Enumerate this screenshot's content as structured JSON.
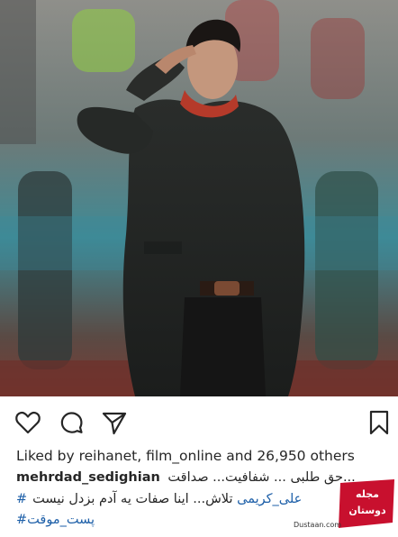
{
  "post": {
    "likes": {
      "prefix": "Liked by ",
      "names": "reihanet, film_online",
      "middle": " and ",
      "count": "26,950 others"
    },
    "caption": {
      "username": "mehrdad_sedighian",
      "line1_text": "حق طلبی ... شفافیت... صداقت...",
      "line2_text": "تلاش... اینا صفات یه آدم بزدل نیست",
      "hashtag1": "#علی_کریمی",
      "hashtag2": "#پست_موقت"
    },
    "icons": {
      "like": "heart-icon",
      "comment": "comment-icon",
      "share": "send-icon",
      "save": "bookmark-icon"
    }
  },
  "watermark": {
    "brand": "مجله دوستان",
    "url": "Dustaan.com"
  },
  "colors": {
    "hashtag": "#1d5fa8",
    "text": "#262626",
    "watermark_red": "#c8102e"
  }
}
